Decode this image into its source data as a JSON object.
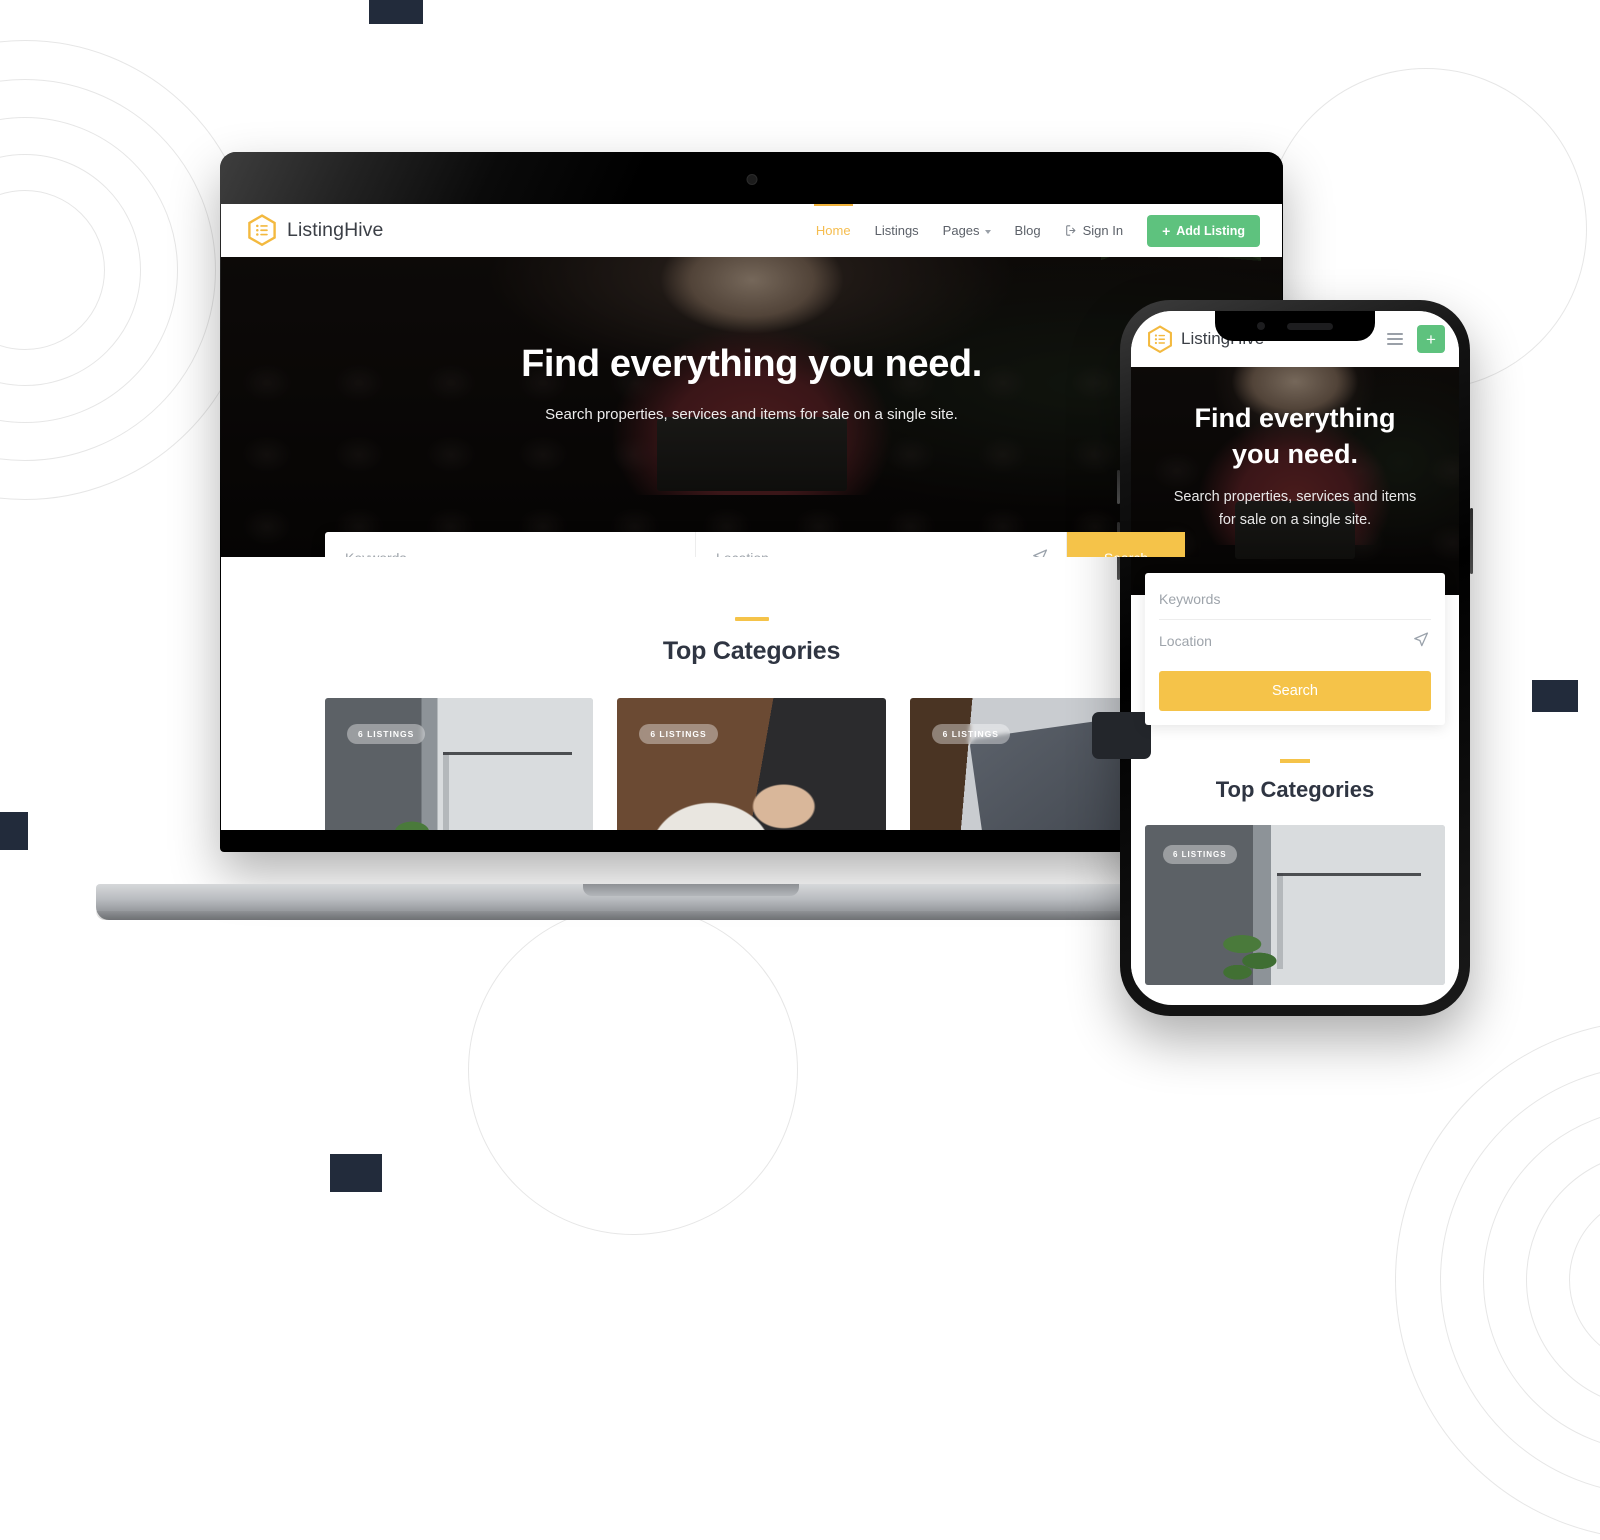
{
  "brand": {
    "name": "ListingHive",
    "logo_icon": "hexagon-list-icon",
    "accent_color": "#f5c349",
    "green_color": "#5ec27e",
    "dark_color": "#2f3542"
  },
  "desktop": {
    "nav": [
      {
        "label": "Home",
        "active": true,
        "icon": null,
        "caret": false
      },
      {
        "label": "Listings",
        "active": false,
        "icon": null,
        "caret": false
      },
      {
        "label": "Pages",
        "active": false,
        "icon": null,
        "caret": true
      },
      {
        "label": "Blog",
        "active": false,
        "icon": null,
        "caret": false
      },
      {
        "label": "Sign In",
        "active": false,
        "icon": "sign-in-icon",
        "caret": false
      }
    ],
    "add_listing_button": {
      "label": "Add Listing",
      "icon": "plus-icon"
    },
    "hero": {
      "title": "Find everything you need.",
      "subtitle": "Search properties, services and items for sale on a single site."
    },
    "search": {
      "keywords_placeholder": "Keywords",
      "location_placeholder": "Location",
      "geo_icon": "location-arrow-icon",
      "button_label": "Search"
    },
    "categories": {
      "heading": "Top Categories",
      "cards": [
        {
          "badge": "6 LISTINGS",
          "image": "closet-clothing-rack-photo"
        },
        {
          "badge": "6 LISTINGS",
          "image": "hands-on-table-photo"
        },
        {
          "badge": "6 LISTINGS",
          "image": "tablet-phone-electronics-photo"
        }
      ]
    }
  },
  "mobile": {
    "menu_icon": "hamburger-menu-icon",
    "add_button_icon": "plus-icon",
    "hero": {
      "title_line1": "Find everything",
      "title_line2": "you need.",
      "subtitle_line1": "Search properties, services and items",
      "subtitle_line2": "for sale on a single site."
    },
    "search": {
      "keywords_placeholder": "Keywords",
      "location_placeholder": "Location",
      "geo_icon": "location-arrow-icon",
      "button_label": "Search"
    },
    "categories": {
      "heading": "Top Categories",
      "cards": [
        {
          "badge": "6 LISTINGS",
          "image": "closet-clothing-rack-photo"
        }
      ]
    }
  }
}
